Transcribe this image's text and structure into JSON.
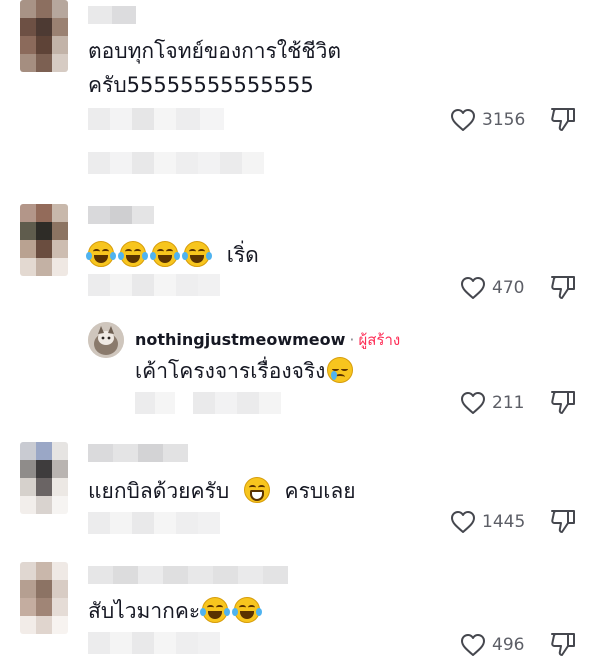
{
  "comments": [
    {
      "text_line1": "ตอบทุกโจทย์ของการใช้ชีวิต",
      "text_line2": "ครับ55555555555555",
      "likes": "3156"
    },
    {
      "text": "เริ่ด",
      "emojis": [
        "face-with-tears-of-joy",
        "face-with-tears-of-joy",
        "face-with-tears-of-joy",
        "face-with-tears-of-joy"
      ],
      "likes": "470"
    },
    {
      "username": "nothingjustmeowmeow",
      "separator": "·",
      "badge": "ผู้สร้าง",
      "text": "เค้าโครงจารเรื่องจริง",
      "emoji": "face-holding-back-tears",
      "likes": "211"
    },
    {
      "text_before": "แยกบิลด้วยครับ",
      "emoji": "grinning-face",
      "text_after": "ครบเลย",
      "likes": "1445"
    },
    {
      "text": "สับไวมากคะ",
      "emojis": [
        "face-with-tears-of-joy",
        "face-with-tears-of-joy"
      ],
      "likes": "496"
    }
  ],
  "icons": {
    "like": "heart-outline-icon",
    "dislike": "thumbs-down-icon"
  },
  "colors": {
    "text": "#161823",
    "muted": "#5c5e66",
    "creator_badge": "#fe2c55"
  }
}
